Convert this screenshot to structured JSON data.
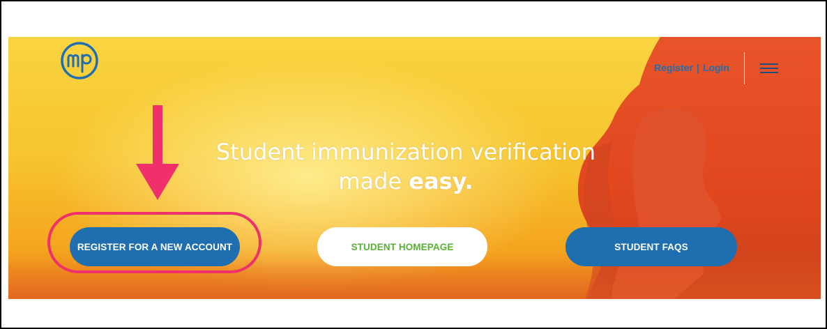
{
  "header": {
    "logo_icon": "mp-logo-icon",
    "register_label": "Register",
    "separator": "|",
    "login_label": "Login",
    "menu_icon": "hamburger-menu-icon"
  },
  "hero": {
    "headline_line1": "Student immunization verification",
    "headline_line2_prefix": "made",
    "headline_line2_bold": "easy."
  },
  "buttons": {
    "register": "REGISTER FOR A NEW ACCOUNT",
    "student_homepage": "STUDENT HOMEPAGE",
    "student_faqs": "STUDENT FAQS"
  },
  "annotation": {
    "arrow_icon": "down-arrow-icon",
    "highlight": "register-highlight-ring"
  },
  "colors": {
    "brand_blue": "#1f6fb0",
    "accent_green": "#56b232",
    "annotation_pink": "#f0306a",
    "hero_yellow": "#f7c52f"
  }
}
